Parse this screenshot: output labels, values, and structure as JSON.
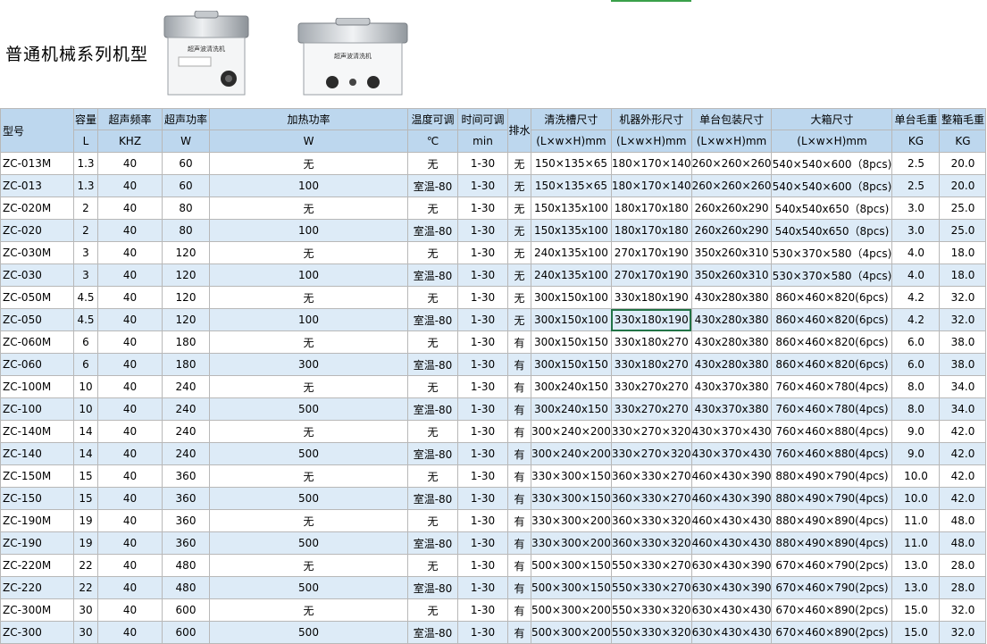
{
  "title": "普通机械系列机型",
  "product_images": [
    {
      "panel_text": "超声波清洗机"
    },
    {
      "panel_text": "超声波清洗机"
    }
  ],
  "header": {
    "row1": [
      "型号",
      "容量",
      "超声频率",
      "超声功率",
      "加热功率",
      "温度可调",
      "时间可调",
      "排水",
      "清洗槽尺寸",
      "机器外形尺寸",
      "单台包装尺寸",
      "大箱尺寸",
      "单台毛重",
      "整箱毛重"
    ],
    "row2": [
      "L",
      "KHZ",
      "W",
      "W",
      "℃",
      "min",
      "(L×w×H)mm",
      "(L×w×H)mm",
      "(L×w×H)mm",
      "(L×w×H)mm",
      "KG",
      "KG"
    ]
  },
  "rows": [
    [
      "ZC-013M",
      "1.3",
      "40",
      "60",
      "无",
      "无",
      "1-30",
      "无",
      "150×135×65",
      "180×170×140",
      "260×260×260",
      "540×540×600（8pcs)",
      "2.5",
      "20.0"
    ],
    [
      "ZC-013",
      "1.3",
      "40",
      "60",
      "100",
      "室温-80",
      "1-30",
      "无",
      "150×135×65",
      "180×170×140",
      "260×260×260",
      "540×540×600（8pcs)",
      "2.5",
      "20.0"
    ],
    [
      "ZC-020M",
      "2",
      "40",
      "80",
      "无",
      "无",
      "1-30",
      "无",
      "150x135x100",
      "180x170x180",
      "260x260x290",
      "540x540x650（8pcs)",
      "3.0",
      "25.0"
    ],
    [
      "ZC-020",
      "2",
      "40",
      "80",
      "100",
      "室温-80",
      "1-30",
      "无",
      "150x135x100",
      "180x170x180",
      "260x260x290",
      "540x540x650（8pcs)",
      "3.0",
      "25.0"
    ],
    [
      "ZC-030M",
      "3",
      "40",
      "120",
      "无",
      "无",
      "1-30",
      "无",
      "240x135x100",
      "270x170x190",
      "350x260x310",
      "530×370×580（4pcs)",
      "4.0",
      "18.0"
    ],
    [
      "ZC-030",
      "3",
      "40",
      "120",
      "100",
      "室温-80",
      "1-30",
      "无",
      "240x135x100",
      "270x170x190",
      "350x260x310",
      "530×370×580（4pcs)",
      "4.0",
      "18.0"
    ],
    [
      "ZC-050M",
      "4.5",
      "40",
      "120",
      "无",
      "无",
      "1-30",
      "无",
      "300x150x100",
      "330x180x190",
      "430x280x380",
      "860×460×820(6pcs)",
      "4.2",
      "32.0"
    ],
    [
      "ZC-050",
      "4.5",
      "40",
      "120",
      "100",
      "室温-80",
      "1-30",
      "无",
      "300x150x100",
      "330x180x190",
      "430x280x380",
      "860×460×820(6pcs)",
      "4.2",
      "32.0"
    ],
    [
      "ZC-060M",
      "6",
      "40",
      "180",
      "无",
      "无",
      "1-30",
      "有",
      "300x150x150",
      "330x180x270",
      "430x280x380",
      "860×460×820(6pcs)",
      "6.0",
      "38.0"
    ],
    [
      "ZC-060",
      "6",
      "40",
      "180",
      "300",
      "室温-80",
      "1-30",
      "有",
      "300x150x150",
      "330x180x270",
      "430x280x380",
      "860×460×820(6pcs)",
      "6.0",
      "38.0"
    ],
    [
      "ZC-100M",
      "10",
      "40",
      "240",
      "无",
      "无",
      "1-30",
      "有",
      "300x240x150",
      "330x270x270",
      "430x370x380",
      "760×460×780(4pcs)",
      "8.0",
      "34.0"
    ],
    [
      "ZC-100",
      "10",
      "40",
      "240",
      "500",
      "室温-80",
      "1-30",
      "有",
      "300x240x150",
      "330x270x270",
      "430x370x380",
      "760×460×780(4pcs)",
      "8.0",
      "34.0"
    ],
    [
      "ZC-140M",
      "14",
      "40",
      "240",
      "无",
      "无",
      "1-30",
      "有",
      "300×240×200",
      "330×270×320",
      "430×370×430",
      "760×460×880(4pcs)",
      "9.0",
      "42.0"
    ],
    [
      "ZC-140",
      "14",
      "40",
      "240",
      "500",
      "室温-80",
      "1-30",
      "有",
      "300×240×200",
      "330×270×320",
      "430×370×430",
      "760×460×880(4pcs)",
      "9.0",
      "42.0"
    ],
    [
      "ZC-150M",
      "15",
      "40",
      "360",
      "无",
      "无",
      "1-30",
      "有",
      "330×300×150",
      "360×330×270",
      "460×430×390",
      "880×490×790(4pcs)",
      "10.0",
      "42.0"
    ],
    [
      "ZC-150",
      "15",
      "40",
      "360",
      "500",
      "室温-80",
      "1-30",
      "有",
      "330×300×150",
      "360×330×270",
      "460×430×390",
      "880×490×790(4pcs)",
      "10.0",
      "42.0"
    ],
    [
      "ZC-190M",
      "19",
      "40",
      "360",
      "无",
      "无",
      "1-30",
      "有",
      "330×300×200",
      "360×330×320",
      "460×430×430",
      "880×490×890(4pcs)",
      "11.0",
      "48.0"
    ],
    [
      "ZC-190",
      "19",
      "40",
      "360",
      "500",
      "室温-80",
      "1-30",
      "有",
      "330×300×200",
      "360×330×320",
      "460×430×430",
      "880×490×890(4pcs)",
      "11.0",
      "48.0"
    ],
    [
      "ZC-220M",
      "22",
      "40",
      "480",
      "无",
      "无",
      "1-30",
      "有",
      "500×300×150",
      "550×330×270",
      "630×430×390",
      "670×460×790(2pcs)",
      "13.0",
      "28.0"
    ],
    [
      "ZC-220",
      "22",
      "40",
      "480",
      "500",
      "室温-80",
      "1-30",
      "有",
      "500×300×150",
      "550×330×270",
      "630×430×390",
      "670×460×790(2pcs)",
      "13.0",
      "28.0"
    ],
    [
      "ZC-300M",
      "30",
      "40",
      "600",
      "无",
      "无",
      "1-30",
      "有",
      "500×300×200",
      "550×330×320",
      "630×430×430",
      "670×460×890(2pcs)",
      "15.0",
      "32.0"
    ],
    [
      "ZC-300",
      "30",
      "40",
      "600",
      "500",
      "室温-80",
      "1-30",
      "有",
      "500×300×200",
      "550×330×320",
      "630×430×430",
      "670×460×890(2pcs)",
      "15.0",
      "32.0"
    ]
  ],
  "selected_cell": {
    "row": 7,
    "col": 9
  },
  "colors": {
    "header_bg": "#bdd7ee",
    "alt_row_bg": "#ddebf7",
    "selection": "#217346"
  }
}
